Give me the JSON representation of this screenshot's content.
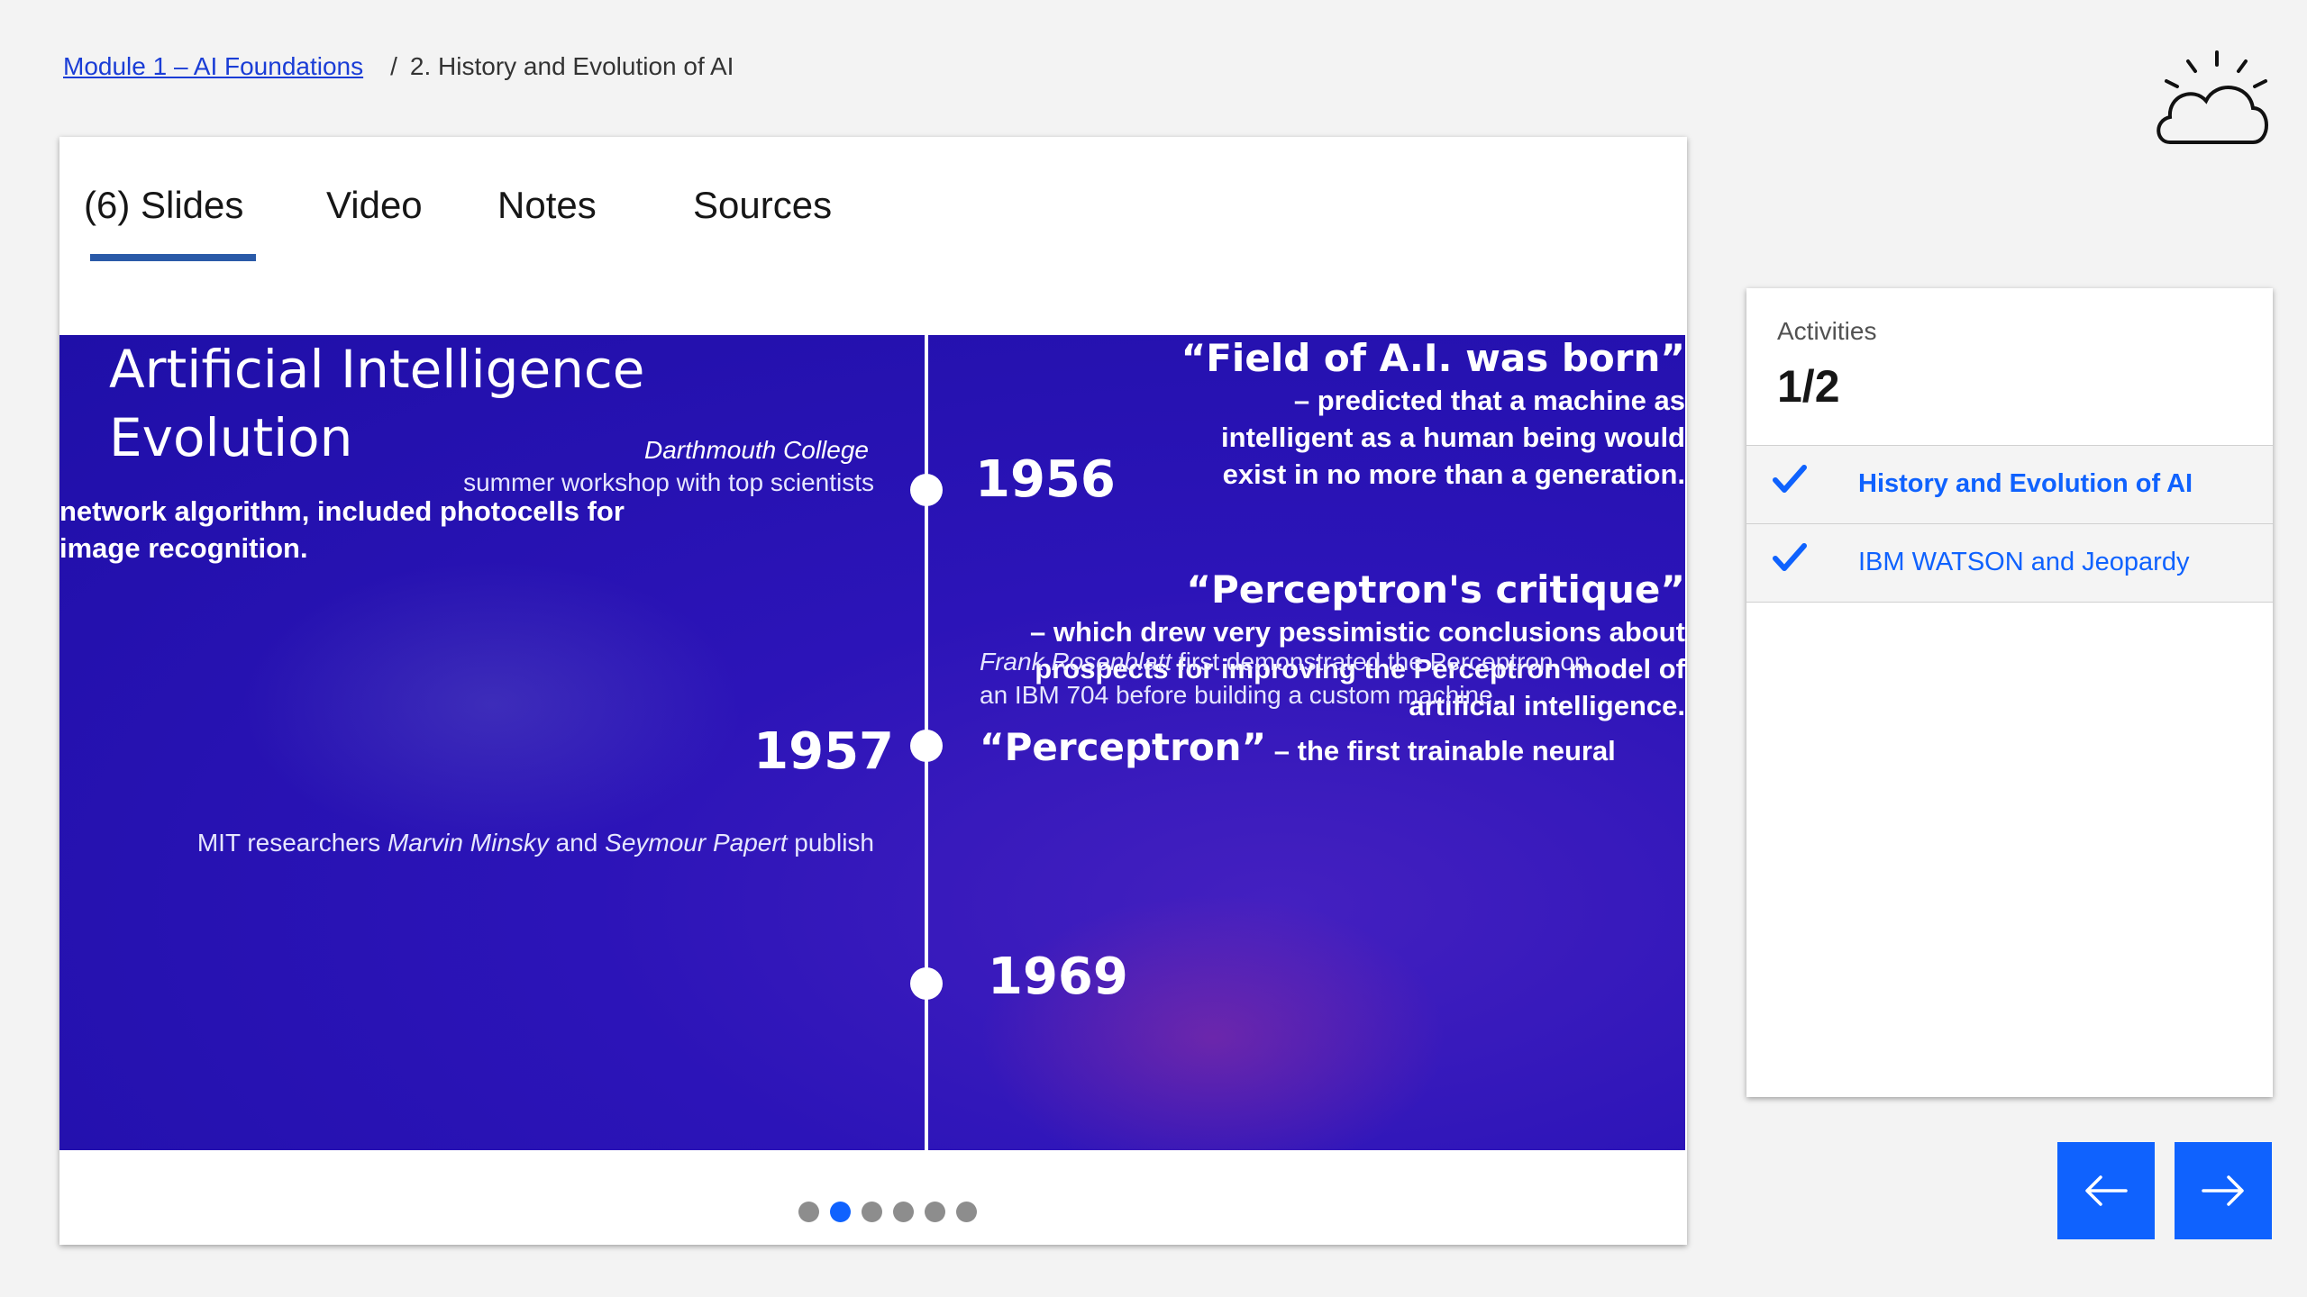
{
  "breadcrumb": {
    "module_link": "Module 1 – AI Foundations",
    "separator": "/",
    "current": "2. History and Evolution of AI"
  },
  "tabs": [
    {
      "label": "(6) Slides",
      "active": true
    },
    {
      "label": "Video"
    },
    {
      "label": "Notes"
    },
    {
      "label": "Sources"
    }
  ],
  "slide": {
    "title_line1": "Artificial Intelligence",
    "title_line2": "Evolution",
    "e1956": {
      "year": "1956",
      "place": "Darthmouth College",
      "desc": "summer workshop with top scientists",
      "quote": "“Field of A.I. was born”",
      "detail1": "– predicted that a machine as",
      "detail2": "intelligent as a human being would",
      "detail3": "exist in no more than a generation."
    },
    "e1957": {
      "year": "1957",
      "person": "Frank Rosenblatt",
      "intro_rest": " first demonstrated the Perceptron on",
      "intro_line2": "an IBM 704 before building a custom machine.",
      "quote": "“Perceptron”",
      "detail1": " – the first trainable neural",
      "detail2": "network algorithm, included photocells for",
      "detail3": "image recognition."
    },
    "e1969": {
      "year": "1969",
      "intro_a": "MIT researchers ",
      "person1": "Marvin Minsky",
      "intro_b": " and ",
      "person2": "Seymour Papert",
      "intro_c": "  publish",
      "quote": "“Perceptron's critique”",
      "detail1": "–  which drew very pessimistic conclusions about",
      "detail2": "prospects for improving the Perceptron model of",
      "detail3": "artificial intelligence."
    }
  },
  "pagination": {
    "total": 6,
    "current": 2
  },
  "activities": {
    "label": "Activities",
    "count": "1/2",
    "items": [
      {
        "label": "History and Evolution of AI",
        "done": true,
        "current": true
      },
      {
        "label": "IBM WATSON and Jeopardy",
        "done": true,
        "current": false
      }
    ]
  },
  "colors": {
    "accent": "#0f62fe",
    "slide_bg": "#2c14b8",
    "tab_underline": "#2a5aa8"
  },
  "icons": {
    "prev": "arrow-left-icon",
    "next": "arrow-right-icon",
    "check": "checkmark-icon",
    "logo": "cloud-sun-icon"
  }
}
